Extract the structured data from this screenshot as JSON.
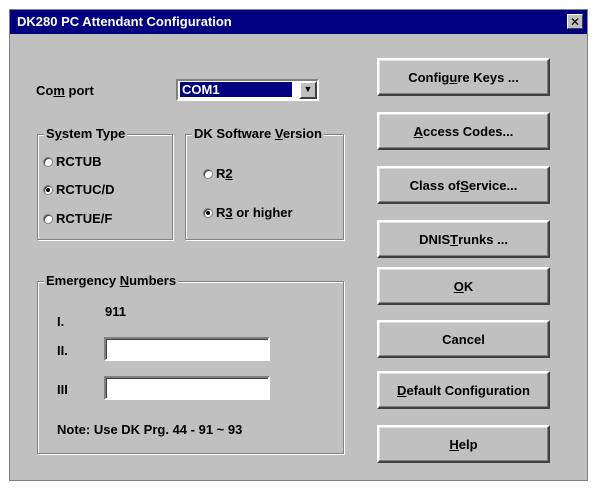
{
  "window": {
    "title": "DK280 PC Attendant Configuration",
    "close_glyph": "✕"
  },
  "com_port": {
    "label_pre": "Co",
    "label_u": "m",
    "label_post": " port",
    "value": "COM1",
    "dropdown_glyph": "▼"
  },
  "system_type": {
    "title_pre": "S",
    "title_u": "y",
    "title_post": "stem Type",
    "options": [
      {
        "label": "RCTUB",
        "checked": false
      },
      {
        "label": "RCTUC/D",
        "checked": true
      },
      {
        "label": "RCTUE/F",
        "checked": false
      }
    ]
  },
  "dk_software": {
    "title_pre": "DK Software ",
    "title_u": "V",
    "title_post": "ersion",
    "options": [
      {
        "label_pre": "R",
        "label_u": "2",
        "label_post": "",
        "checked": false
      },
      {
        "label_pre": "R",
        "label_u": "3",
        "label_post": " or higher",
        "checked": true
      }
    ]
  },
  "emergency": {
    "title_pre": "Emergency ",
    "title_u": "N",
    "title_post": "umbers",
    "rows": [
      {
        "label": "I.",
        "value": "911"
      },
      {
        "label": "II.",
        "value": ""
      },
      {
        "label": "III",
        "value": ""
      }
    ],
    "note": "Note:  Use DK Prg. 44 - 91 ~ 93"
  },
  "buttons": {
    "configure_keys": {
      "pre": "Config",
      "u": "u",
      "post": "re Keys ..."
    },
    "access_codes": {
      "pre": "",
      "u": "A",
      "post": "ccess  Codes..."
    },
    "class_of_service": {
      "pre": "Class of ",
      "u": "S",
      "post": "ervice..."
    },
    "dnis_trunks": {
      "pre": "DNIS ",
      "u": "T",
      "post": "runks ..."
    },
    "ok": {
      "pre": "",
      "u": "O",
      "post": "K"
    },
    "cancel": {
      "pre": "Cancel",
      "u": "",
      "post": ""
    },
    "default_config": {
      "pre": "",
      "u": "D",
      "post": "efault Configuration"
    },
    "help": {
      "pre": "",
      "u": "H",
      "post": "elp"
    }
  }
}
